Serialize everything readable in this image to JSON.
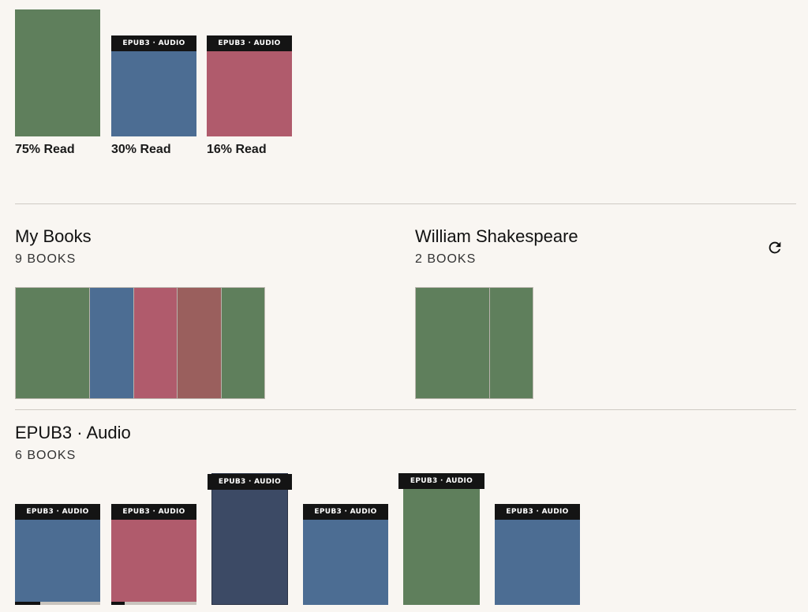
{
  "colors": {
    "green": "#5f7f5c",
    "blue": "#4c6d93",
    "rose": "#b05b6c",
    "brick": "#9a5f5d",
    "navy": "#3c4a65",
    "badge_bg": "#141414",
    "background": "#f9f6f2"
  },
  "continue_reading": [
    {
      "progress_label": "75% Read",
      "badge": "",
      "color": "green"
    },
    {
      "progress_label": "30% Read",
      "badge": "EPUB3 · AUDIO",
      "color": "blue"
    },
    {
      "progress_label": "16% Read",
      "badge": "EPUB3 · AUDIO",
      "color": "rose"
    }
  ],
  "shelves": [
    {
      "title": "My Books",
      "count": "9 BOOKS",
      "spines": [
        "green",
        "blue",
        "rose",
        "brick",
        "green"
      ]
    },
    {
      "title": "William Shakespeare",
      "count": "2 BOOKS",
      "spines": [
        "green",
        "green"
      ]
    }
  ],
  "refresh_icon": "refresh-icon",
  "epub_section": {
    "title": "EPUB3 · Audio",
    "count": "6 BOOKS",
    "books": [
      {
        "badge": "EPUB3 · AUDIO",
        "color": "blue",
        "progress": 0.3
      },
      {
        "badge": "EPUB3 · AUDIO",
        "color": "rose",
        "progress": 0.16
      },
      {
        "badge": "EPUB3 · AUDIO",
        "color": "navy",
        "progress": 0
      },
      {
        "badge": "EPUB3 · AUDIO",
        "color": "blue",
        "progress": 0
      },
      {
        "badge": "EPUB3 · AUDIO",
        "color": "green",
        "progress": 0
      },
      {
        "badge": "EPUB3 · AUDIO",
        "color": "blue",
        "progress": 0
      }
    ]
  }
}
